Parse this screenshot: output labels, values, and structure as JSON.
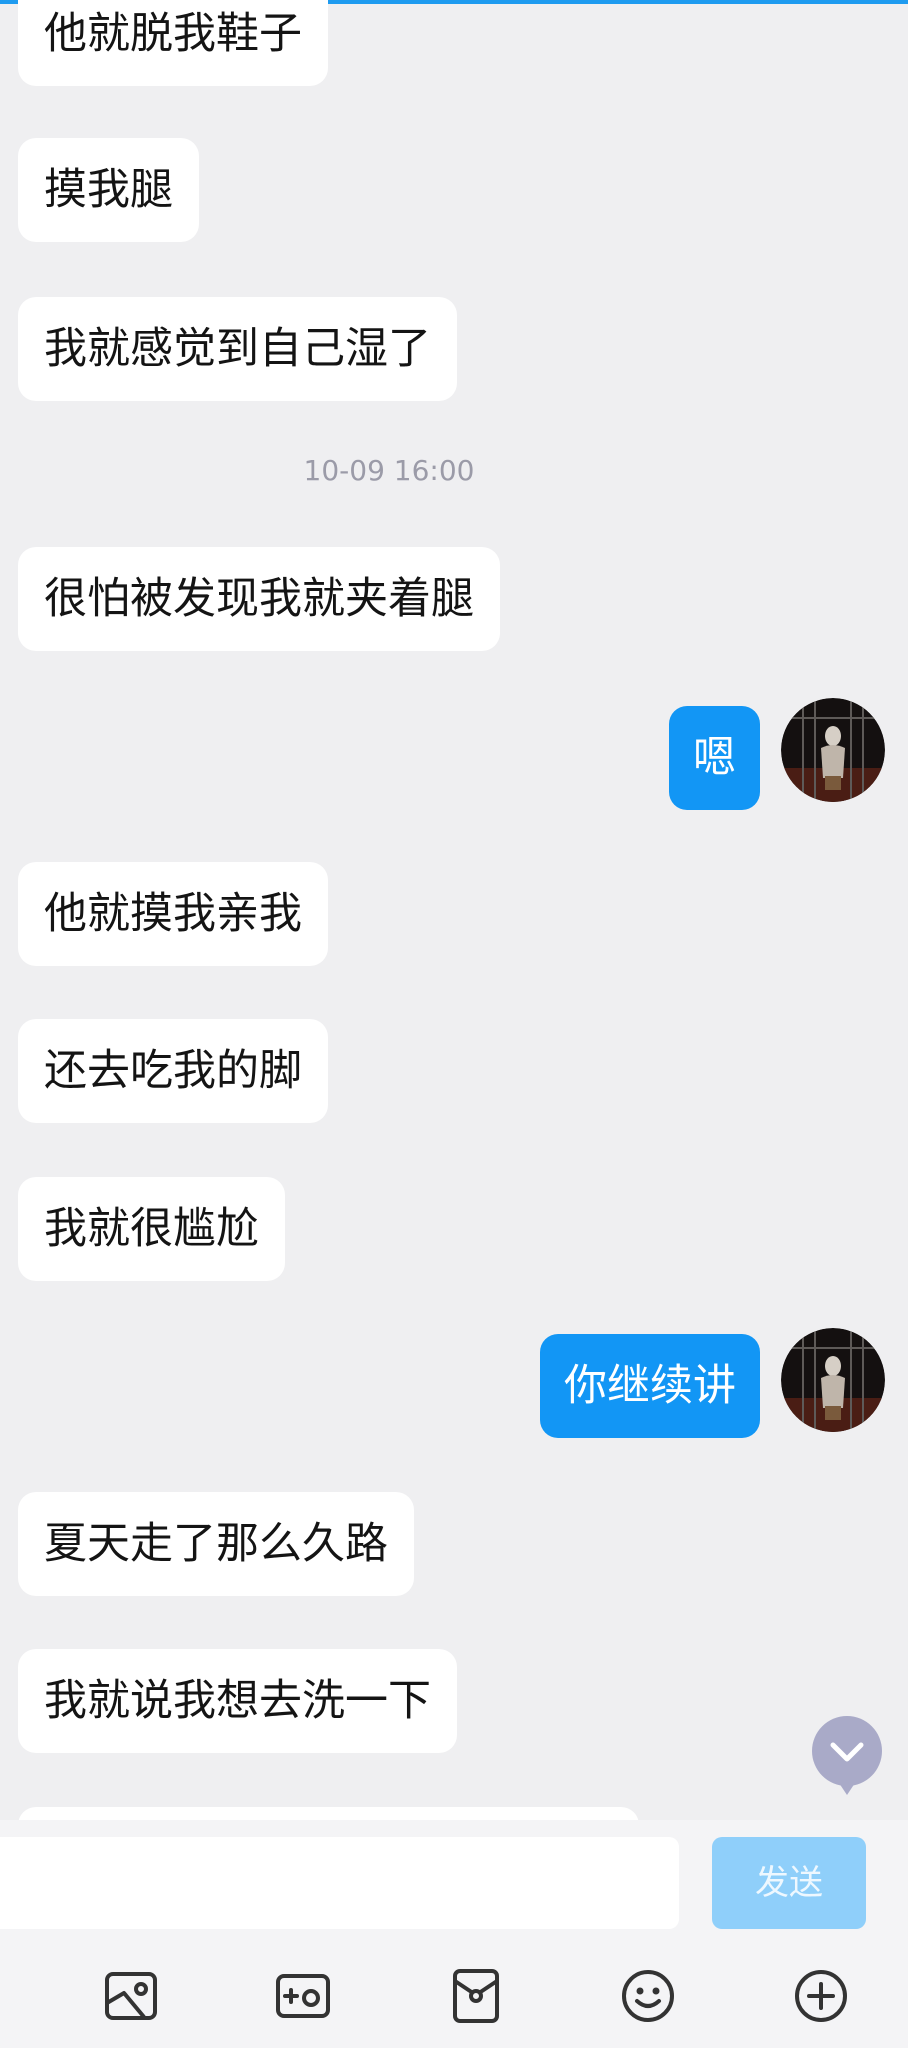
{
  "colors": {
    "background": "#efeff1",
    "bubble_left": "#ffffff",
    "bubble_right": "#1296f5",
    "accent": "#1e9bf0",
    "send_button": "#8fcffa",
    "timestamp": "#9b9ba8",
    "scroll_button": "#a9aac8"
  },
  "messages": [
    {
      "side": "left",
      "text": "他就脱我鞋子"
    },
    {
      "side": "left",
      "text": "摸我腿"
    },
    {
      "side": "left",
      "text": "我就感觉到自己湿了"
    },
    {
      "side": "left",
      "text": "很怕被发现我就夹着腿"
    },
    {
      "side": "right",
      "text": "嗯"
    },
    {
      "side": "left",
      "text": "他就摸我亲我"
    },
    {
      "side": "left",
      "text": "还去吃我的脚"
    },
    {
      "side": "left",
      "text": "我就很尴尬"
    },
    {
      "side": "right",
      "text": "你继续讲"
    },
    {
      "side": "left",
      "text": "夏天走了那么久路"
    },
    {
      "side": "left",
      "text": "我就说我想去洗一下"
    }
  ],
  "timestamp": "10-09 16:00",
  "scroll_button": {
    "icon": "chevron-down-icon"
  },
  "composer": {
    "input_value": "",
    "send_label": "发送"
  },
  "toolbar": {
    "icons": [
      "image-icon",
      "camera-icon",
      "red-packet-icon",
      "emoji-icon",
      "plus-circle-icon"
    ]
  }
}
